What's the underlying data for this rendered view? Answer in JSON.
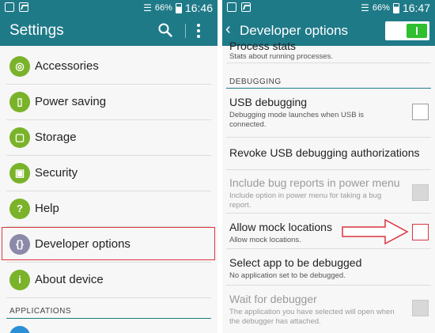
{
  "colors": {
    "accent": "#1f7a88",
    "highlight": "#d9363e",
    "icon_green": "#7ab32a",
    "toggle_on": "#2fbf2f"
  },
  "left": {
    "status": {
      "battery": "66%",
      "time": "16:46"
    },
    "title": "Settings",
    "items": [
      {
        "label": "Accessories",
        "icon": "accessories-icon"
      },
      {
        "label": "Power saving",
        "icon": "battery-icon"
      },
      {
        "label": "Storage",
        "icon": "sd-card-icon"
      },
      {
        "label": "Security",
        "icon": "lock-icon"
      },
      {
        "label": "Help",
        "icon": "help-icon"
      },
      {
        "label": "Developer options",
        "icon": "braces-icon"
      },
      {
        "label": "About device",
        "icon": "info-icon"
      }
    ],
    "section": "APPLICATIONS"
  },
  "right": {
    "status": {
      "battery": "66%",
      "time": "16:47"
    },
    "title": "Developer options",
    "master_toggle_on": true,
    "top_partial": {
      "title": "Process stats",
      "desc": "Stats about running processes."
    },
    "section": "DEBUGGING",
    "items": [
      {
        "title": "USB debugging",
        "desc": "Debugging mode launches when USB is connected.",
        "checkbox": true,
        "checked": false,
        "enabled": true
      },
      {
        "title": "Revoke USB debugging authorizations",
        "desc": "",
        "checkbox": false,
        "enabled": true
      },
      {
        "title": "Include bug reports in power menu",
        "desc": "Include option in power menu for taking a bug report.",
        "checkbox": true,
        "checked": false,
        "enabled": false
      },
      {
        "title": "Allow mock locations",
        "desc": "Allow mock locations.",
        "checkbox": true,
        "checked": false,
        "enabled": true
      },
      {
        "title": "Select app to be debugged",
        "desc": "No application set to be debugged.",
        "checkbox": false,
        "enabled": true
      },
      {
        "title": "Wait for debugger",
        "desc": "The application you have selected will open when the debugger has attached.",
        "checkbox": true,
        "checked": false,
        "enabled": false
      }
    ]
  }
}
